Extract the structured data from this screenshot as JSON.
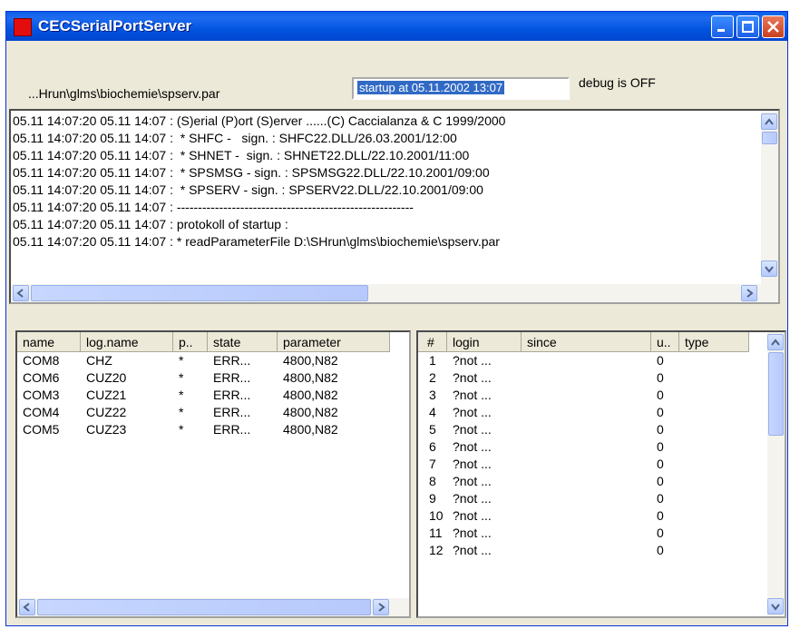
{
  "window": {
    "title": "CECSerialPortServer",
    "buttons": [
      "minimize",
      "maximize",
      "close"
    ]
  },
  "info": {
    "param_path": "...Hrun\\glms\\biochemie\\spserv.par",
    "startup": "startup at 05.11.2002 13:07",
    "debug": "debug is OFF"
  },
  "log": [
    "05.11 14:07:20 05.11 14:07 : (S)erial (P)ort (S)erver ......(C) Caccialanza & C 1999/2000",
    "05.11 14:07:20 05.11 14:07 :  * SHFC -   sign. : SHFC22.DLL/26.03.2001/12:00",
    "05.11 14:07:20 05.11 14:07 :  * SHNET -  sign. : SHNET22.DLL/22.10.2001/11:00",
    "05.11 14:07:20 05.11 14:07 :  * SPSMSG - sign. : SPSMSG22.DLL/22.10.2001/09:00",
    "05.11 14:07:20 05.11 14:07 :  * SPSERV - sign. : SPSERV22.DLL/22.10.2001/09:00",
    "05.11 14:07:20 05.11 14:07 : --------------------------------------------------------",
    "05.11 14:07:20 05.11 14:07 : protokoll of startup :",
    "05.11 14:07:20 05.11 14:07 : * readParameterFile D:\\SHrun\\glms\\biochemie\\spserv.par"
  ],
  "ports": {
    "columns": [
      "name",
      "log.name",
      "p..",
      "state",
      "parameter"
    ],
    "rows": [
      [
        "COM8",
        "CHZ",
        "*",
        "ERR...",
        "4800,N82"
      ],
      [
        "COM6",
        "CUZ20",
        "*",
        "ERR...",
        "4800,N82"
      ],
      [
        "COM3",
        "CUZ21",
        "*",
        "ERR...",
        "4800,N82"
      ],
      [
        "COM4",
        "CUZ22",
        "*",
        "ERR...",
        "4800,N82"
      ],
      [
        "COM5",
        "CUZ23",
        "*",
        "ERR...",
        "4800,N82"
      ]
    ]
  },
  "sessions": {
    "columns": [
      "#",
      "login",
      "since",
      "u..",
      "type"
    ],
    "rows": [
      [
        "1",
        "?not ...",
        "",
        "0",
        ""
      ],
      [
        "2",
        "?not ...",
        "",
        "0",
        ""
      ],
      [
        "3",
        "?not ...",
        "",
        "0",
        ""
      ],
      [
        "4",
        "?not ...",
        "",
        "0",
        ""
      ],
      [
        "5",
        "?not ...",
        "",
        "0",
        ""
      ],
      [
        "6",
        "?not ...",
        "",
        "0",
        ""
      ],
      [
        "7",
        "?not ...",
        "",
        "0",
        ""
      ],
      [
        "8",
        "?not ...",
        "",
        "0",
        ""
      ],
      [
        "9",
        "?not ...",
        "",
        "0",
        ""
      ],
      [
        "10",
        "?not ...",
        "",
        "0",
        ""
      ],
      [
        "11",
        "?not ...",
        "",
        "0",
        ""
      ],
      [
        "12",
        "?not ...",
        "",
        "0",
        ""
      ]
    ]
  },
  "colors": {
    "title_bar": "#0254e0",
    "close_button": "#c8401e",
    "selection": "#316ac5",
    "face": "#ece9d8"
  }
}
